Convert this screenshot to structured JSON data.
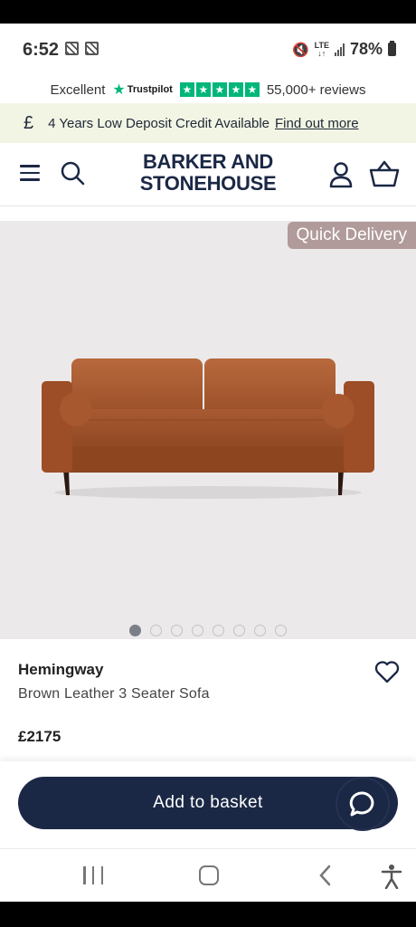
{
  "status_bar": {
    "time": "6:52",
    "network": "LTE",
    "battery": "78%"
  },
  "trustpilot": {
    "rating_word": "Excellent",
    "brand": "Trustpilot",
    "stars": 5,
    "reviews": "55,000+ reviews",
    "accent": "#00b67a"
  },
  "credit_banner": {
    "currency_symbol": "£",
    "text": "4 Years Low Deposit Credit Available",
    "link": "Find out more"
  },
  "header": {
    "logo_line1": "BARKER AND",
    "logo_line2": "STONEHOUSE",
    "icons": [
      "menu-icon",
      "search-icon",
      "account-icon",
      "basket-icon"
    ],
    "brand_color": "#1b2845"
  },
  "hero": {
    "badge": "Quick Delivery",
    "image_alt": "brown leather three seater sofa",
    "slide_count": 8,
    "active_slide": 1
  },
  "product": {
    "name": "Hemingway",
    "description": "Brown Leather 3 Seater Sofa",
    "price": "£2175"
  },
  "actions": {
    "add_to_basket": "Add to basket",
    "chat": "chat-icon"
  },
  "nav_bar": {
    "icons": [
      "recent-apps-icon",
      "home-icon",
      "back-icon",
      "accessibility-icon"
    ]
  }
}
